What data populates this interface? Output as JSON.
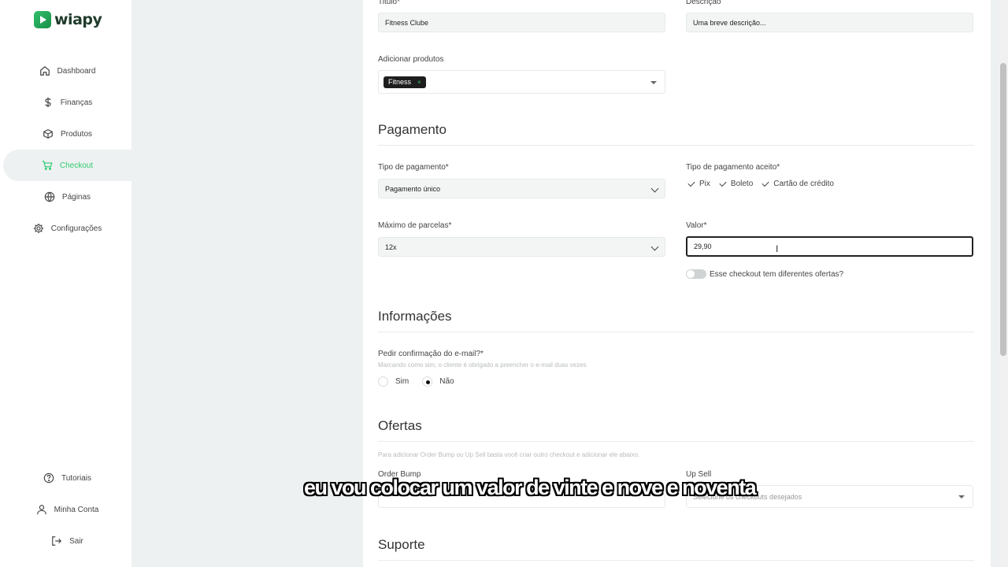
{
  "app": {
    "logo_text": "wiapy"
  },
  "sidebar": {
    "items": [
      {
        "label": "Dashboard",
        "icon": "home-icon"
      },
      {
        "label": "Finanças",
        "icon": "dollar-icon"
      },
      {
        "label": "Produtos",
        "icon": "box-icon"
      },
      {
        "label": "Checkout",
        "icon": "cart-icon",
        "active": true
      },
      {
        "label": "Páginas",
        "icon": "globe-icon"
      },
      {
        "label": "Configurações",
        "icon": "gear-icon"
      }
    ],
    "bottom": [
      {
        "label": "Tutoriais",
        "icon": "help-icon"
      },
      {
        "label": "Minha Conta",
        "icon": "user-icon"
      },
      {
        "label": "Sair",
        "icon": "logout-icon"
      }
    ],
    "active_color": "#2ecc71"
  },
  "form": {
    "titulo_label": "Titulo*",
    "titulo_value": "Fitness Clube",
    "descricao_label": "Descrição",
    "descricao_value": "Uma breve descrição...",
    "produtos_label": "Adicionar produtos",
    "produtos_chip": "Fitness",
    "produtos_chip_remove": "×"
  },
  "pagamento": {
    "heading": "Pagamento",
    "tipo_label": "Tipo de pagamento*",
    "tipo_value": "Pagamento único",
    "aceito_label": "Tipo de pagamento aceito*",
    "aceito_options": [
      "Pix",
      "Boleto",
      "Cartão de crédito"
    ],
    "parcelas_label": "Máximo de parcelas*",
    "parcelas_value": "12x",
    "valor_label": "Valor*",
    "valor_value": "29,90",
    "ofertas_toggle_label": "Esse checkout tem diferentes ofertas?"
  },
  "informacoes": {
    "heading": "Informações",
    "email_label": "Pedir confirmação do e-mail?*",
    "email_hint": "Marcando como sim, o cliente é obrigado a preencher o e-mail duas vezes",
    "option_sim": "Sim",
    "option_nao": "Não",
    "selected": "Não"
  },
  "ofertas": {
    "heading": "Ofertas",
    "hint": "Para adicionar Order Bump ou Up Sell basta você criar outro checkout e adicionar ele abaixo.",
    "order_bump_label": "Order Bump",
    "up_sell_label": "Up Sell",
    "up_sell_placeholder": "Selecione os checkouts desejados"
  },
  "suporte": {
    "heading": "Suporte"
  },
  "caption": "eu vou colocar um valor de vinte e nove e noventa"
}
